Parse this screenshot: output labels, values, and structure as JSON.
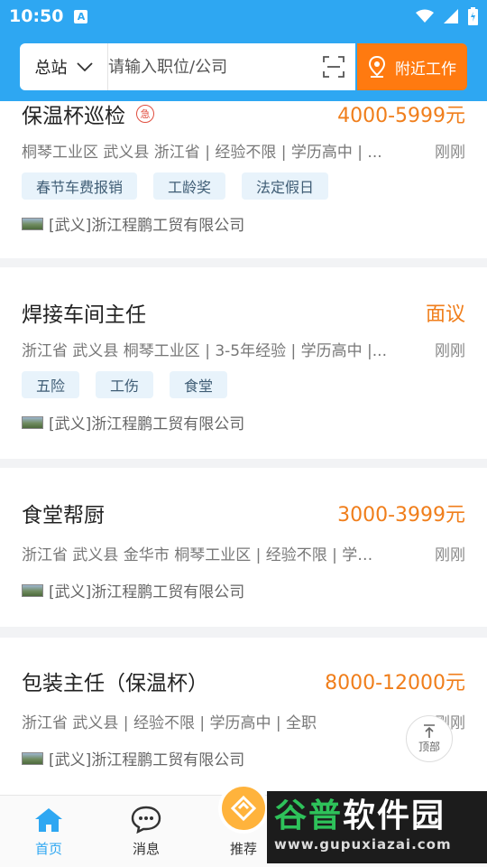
{
  "status": {
    "time": "10:50",
    "a_badge": "A"
  },
  "search": {
    "station": "总站",
    "placeholder": "请输入职位/公司",
    "nearby_label": "附近工作"
  },
  "jobs": [
    {
      "title": "保温杯巡检",
      "urgent": "急",
      "salary": "4000-5999元",
      "meta": "桐琴工业区 武义县 浙江省 | 经验不限 | 学历高中 | ...",
      "time": "刚刚",
      "tags": [
        "春节车费报销",
        "工龄奖",
        "法定假日"
      ],
      "company": "[武义]浙江程鹏工贸有限公司"
    },
    {
      "title": "焊接车间主任",
      "salary": "面议",
      "meta": "浙江省 武义县 桐琴工业区 | 3-5年经验 | 学历高中 |...",
      "time": "刚刚",
      "tags": [
        "五险",
        "工伤",
        "食堂"
      ],
      "company": "[武义]浙江程鹏工贸有限公司"
    },
    {
      "title": "食堂帮厨",
      "salary": "3000-3999元",
      "meta": "浙江省 武义县 金华市 桐琴工业区 | 经验不限 | 学…",
      "time": "刚刚",
      "tags": [],
      "company": "[武义]浙江程鹏工贸有限公司"
    },
    {
      "title": "包装主任（保温杯）",
      "salary": "8000-12000元",
      "meta": "浙江省 武义县 | 经验不限 | 学历高中 | 全职",
      "time": "刚刚",
      "tags": [],
      "company": "[武义]浙江程鹏工贸有限公司"
    }
  ],
  "top_button": "顶部",
  "nav": {
    "home": "首页",
    "messages": "消息",
    "recommend": "推荐"
  },
  "watermark": {
    "cn_green": "谷普",
    "cn_white": "软件园",
    "url": "www.gupuxiazai.com"
  },
  "colors": {
    "primary": "#2ea7f2",
    "accent": "#ff7a10",
    "salary": "#f07e1b"
  }
}
